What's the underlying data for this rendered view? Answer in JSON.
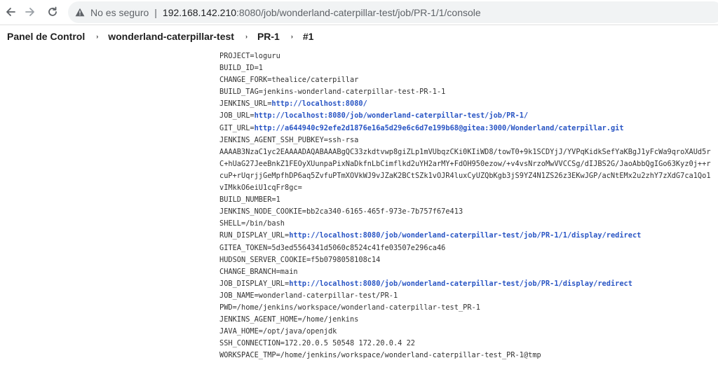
{
  "browser": {
    "security_label": "No es seguro",
    "separator": "|",
    "url_host": "192.168.142.210",
    "url_rest": ":8080/job/wonderland-caterpillar-test/job/PR-1/1/console",
    "icons": [
      "back-arrow-icon",
      "forward-arrow-icon",
      "reload-icon",
      "warning-icon"
    ]
  },
  "breadcrumb": {
    "items": [
      "Panel de Control",
      "wonderland-caterpillar-test",
      "PR-1",
      "#1"
    ],
    "separator": "›"
  },
  "console": {
    "lines": [
      {
        "text": "PROJECT=loguru"
      },
      {
        "text": "BUILD_ID=1"
      },
      {
        "text": "CHANGE_FORK=thealice/caterpillar"
      },
      {
        "text": "BUILD_TAG=jenkins-wonderland-caterpillar-test-PR-1-1"
      },
      {
        "text": "JENKINS_URL=",
        "link": "http://localhost:8080/"
      },
      {
        "text": "JOB_URL=",
        "link": "http://localhost:8080/job/wonderland-caterpillar-test/job/PR-1/"
      },
      {
        "text": "GIT_URL=",
        "link": "http://a644940c92efe2d1876e16a5d29e6c6d7e199b68@gitea:3000/Wonderland/caterpillar.git"
      },
      {
        "text": "JENKINS_AGENT_SSH_PUBKEY=ssh-rsa"
      },
      {
        "text": "AAAAB3NzaC1yc2EAAAADAQABAAABgQC33zkdtvwp8giZLp1mVUbqzCKi0KIiWD8/towT0+9k1SCDYjJ/YVPqKidkSefYaKBgJ1yFcWa9qroXAUd5r"
      },
      {
        "text": "C+hUaG27JeeBnkZ1FEOyXUunpaPixNaDkfnLbCimflkd2uYH2arMY+FdOH950ezow/+v4vsNrzoMwVVCCSg/dIJBS2G/JaoAbbQgIGo63Kyz0j++r"
      },
      {
        "text": "cuP+rUqrjjGeMpfhDP6aq5ZvfuPTmXOVkWJ9vJZaK2BCtSZk1vOJR4luxCyUZQbKgb3jS9YZ4N1ZS26z3EKwJGP/acNtEMx2u2zhY7zXdG7ca1Qo1"
      },
      {
        "text": "vIMkkO6eiU1cqFr8gc="
      },
      {
        "text": "BUILD_NUMBER=1"
      },
      {
        "text": "JENKINS_NODE_COOKIE=bb2ca340-6165-465f-973e-7b757f67e413"
      },
      {
        "text": "SHELL=/bin/bash"
      },
      {
        "text": "RUN_DISPLAY_URL=",
        "link": "http://localhost:8080/job/wonderland-caterpillar-test/job/PR-1/1/display/redirect"
      },
      {
        "text": "GITEA_TOKEN=5d3ed5564341d5060c8524c41fe03507e296ca46"
      },
      {
        "text": "HUDSON_SERVER_COOKIE=f5b0798058108c14"
      },
      {
        "text": "CHANGE_BRANCH=main"
      },
      {
        "text": "JOB_DISPLAY_URL=",
        "link": "http://localhost:8080/job/wonderland-caterpillar-test/job/PR-1/display/redirect"
      },
      {
        "text": "JOB_NAME=wonderland-caterpillar-test/PR-1"
      },
      {
        "text": "PWD=/home/jenkins/workspace/wonderland-caterpillar-test_PR-1"
      },
      {
        "text": "JENKINS_AGENT_HOME=/home/jenkins"
      },
      {
        "text": "JAVA_HOME=/opt/java/openjdk"
      },
      {
        "text": "SSH_CONNECTION=172.20.0.5 50548 172.20.0.4 22"
      },
      {
        "text": "WORKSPACE_TMP=/home/jenkins/workspace/wonderland-caterpillar-test_PR-1@tmp"
      }
    ]
  }
}
